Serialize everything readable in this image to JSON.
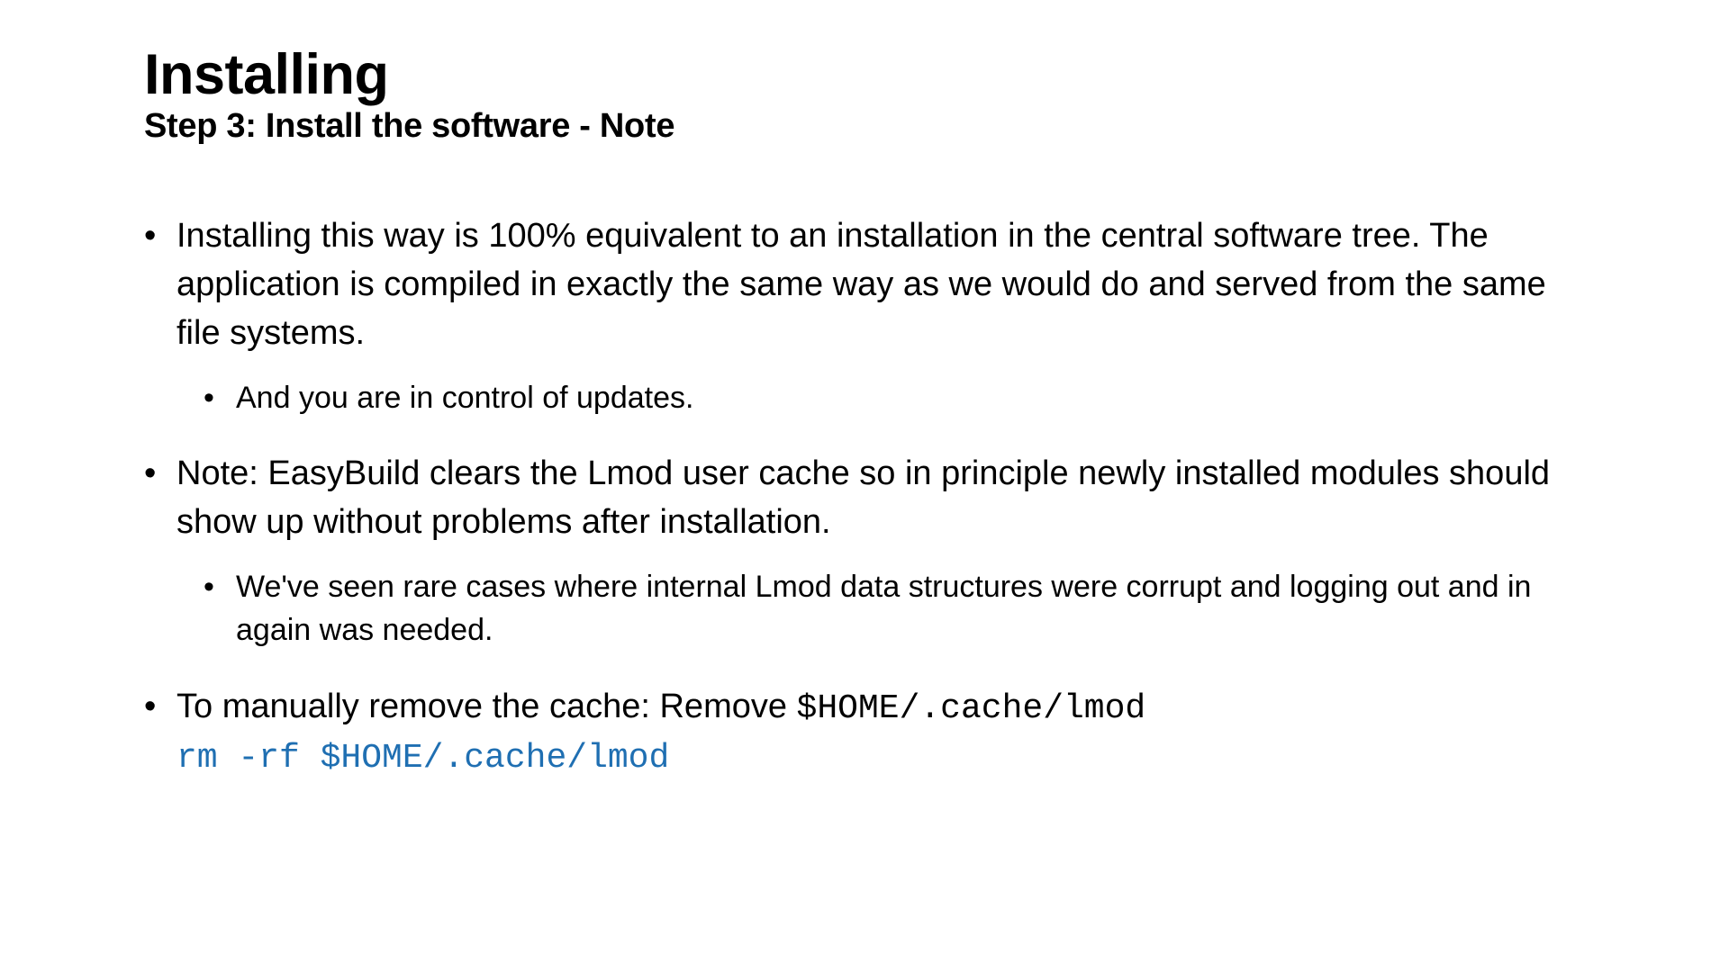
{
  "slide": {
    "title": "Installing",
    "subtitle": "Step 3: Install the software - Note",
    "bullets": [
      {
        "text": "Installing this way is 100% equivalent to an installation in the central software tree. The application is compiled in exactly the same way as we would do and served from the same file systems.",
        "sub": [
          {
            "text": "And you are in control of updates."
          }
        ]
      },
      {
        "text": "Note: EasyBuild clears the Lmod user cache so in principle newly installed modules should show up without problems after installation.",
        "sub": [
          {
            "text": "We've seen rare cases where internal Lmod data structures were corrupt and logging out and in again was needed."
          }
        ]
      },
      {
        "text_pre": "To manually remove the cache: Remove ",
        "text_code": "$HOME/.cache/lmod",
        "command": "rm -rf $HOME/.cache/lmod"
      }
    ]
  }
}
